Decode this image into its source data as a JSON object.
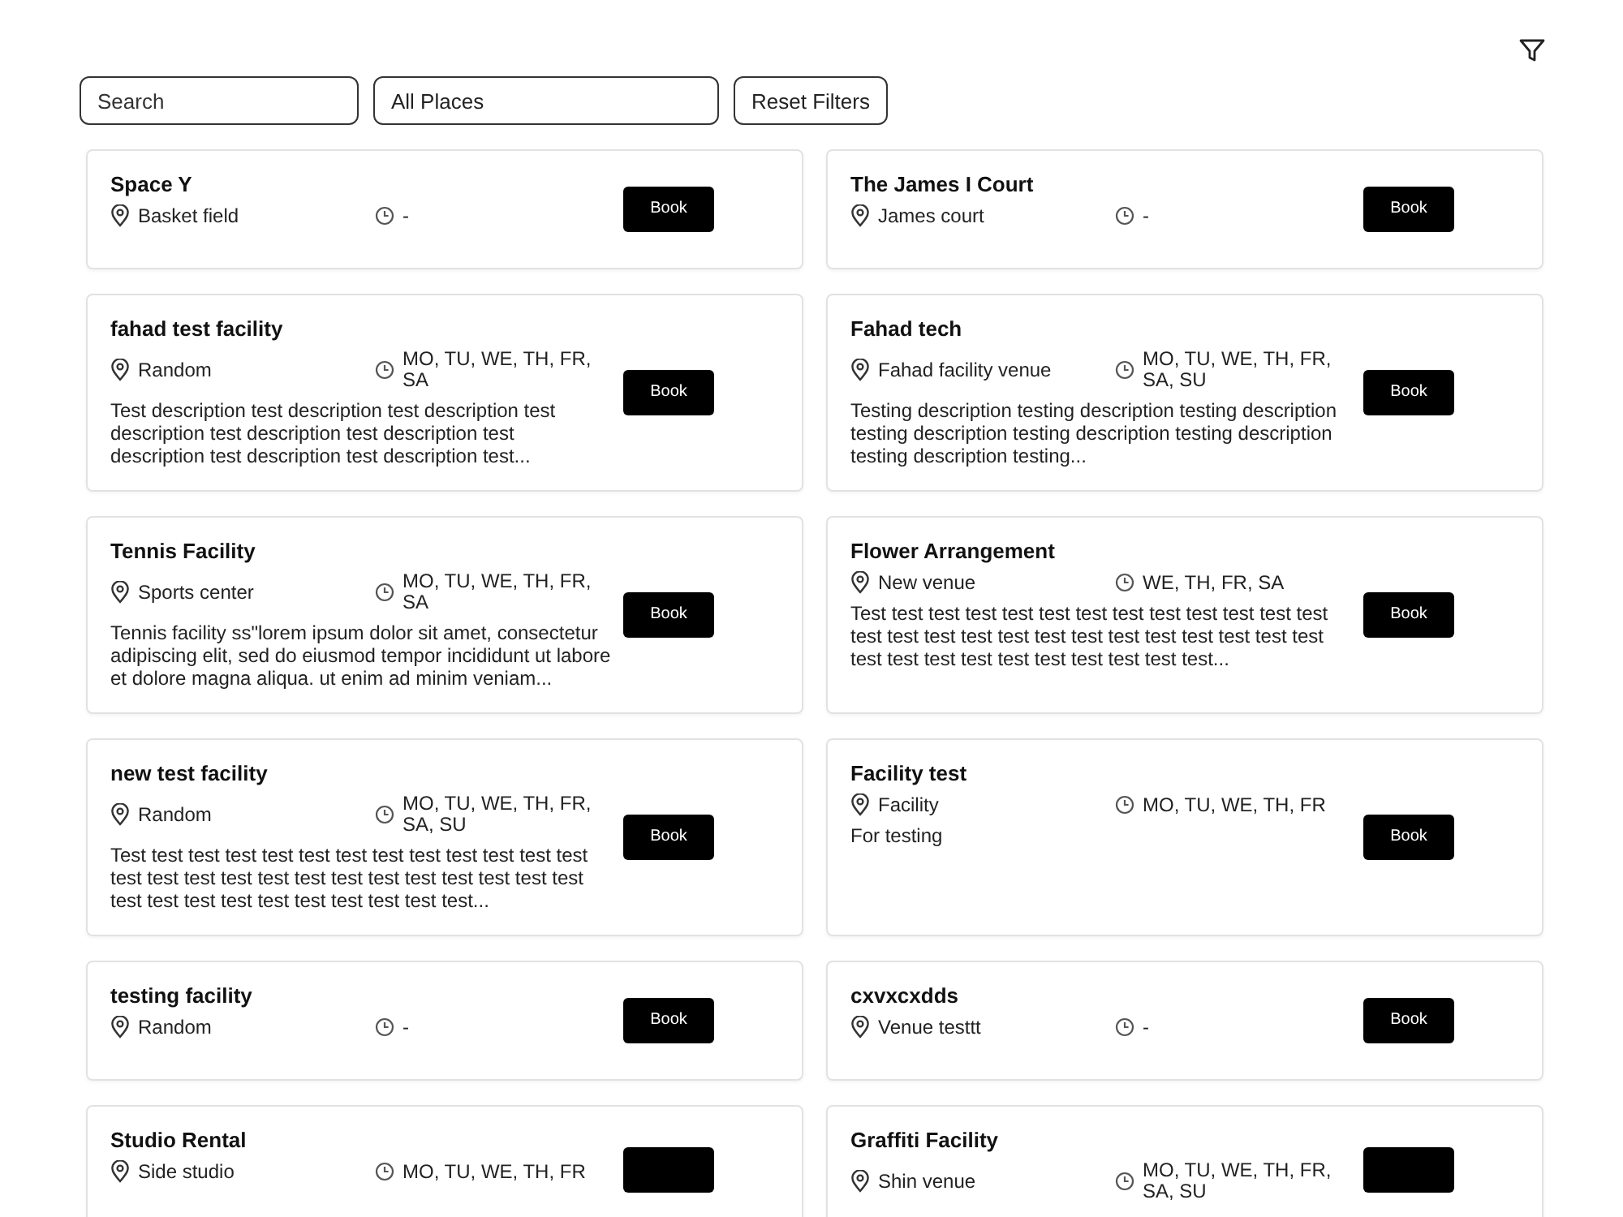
{
  "filters": {
    "search": {
      "placeholder": "Search"
    },
    "place": {
      "value": "All Places"
    },
    "reset": "Reset Filters"
  },
  "facilities": [
    {
      "name": "Space Y",
      "location": "Basket field",
      "days": "-",
      "book": "Book"
    },
    {
      "name": "The James I Court",
      "location": "James court",
      "days": "-",
      "book": "Book"
    },
    {
      "name": "fahad test facility",
      "location": "Random",
      "days": "MO, TU, WE, TH, FR, SA",
      "description": "Test description test description test description test description test description test description test description test description test description test...",
      "book": "Book"
    },
    {
      "name": "Fahad tech",
      "location": "Fahad facility venue",
      "days": "MO, TU, WE, TH, FR, SA, SU",
      "description": "Testing description testing description testing description testing description testing description testing description testing description testing...",
      "book": "Book"
    },
    {
      "name": "Tennis Facility",
      "location": "Sports center",
      "days": "MO, TU, WE, TH, FR, SA",
      "description": "Tennis facility ss\"lorem ipsum dolor sit amet, consectetur adipiscing elit, sed do eiusmod tempor incididunt ut labore et dolore magna aliqua. ut enim ad minim veniam...",
      "book": "Book"
    },
    {
      "name": "Flower Arrangement",
      "location": "New venue",
      "days": "WE, TH, FR, SA",
      "description": "Test test test test test test test test test test test test test test test test test test test test test test test test test test test test test test test test test test test test...",
      "book": "Book"
    },
    {
      "name": "new test facility",
      "location": "Random",
      "days": "MO, TU, WE, TH, FR, SA, SU",
      "description": "Test test test test test test test test test test test test test test test test test test test test test test test test test test test test test test test test test test test test...",
      "book": "Book"
    },
    {
      "name": "Facility test",
      "location": "Facility",
      "days": "MO, TU, WE, TH, FR",
      "description": "For testing",
      "book": "Book"
    },
    {
      "name": "testing facility",
      "location": "Random",
      "days": "-",
      "book": "Book"
    },
    {
      "name": "cxvxcxdds",
      "location": "Venue testtt",
      "days": "-",
      "book": "Book"
    },
    {
      "name": "Studio Rental",
      "location": "Side studio",
      "days": "MO, TU, WE, TH, FR"
    },
    {
      "name": "Graffiti Facility",
      "location": "Shin venue",
      "days": "MO, TU, WE, TH, FR, SA, SU"
    }
  ]
}
